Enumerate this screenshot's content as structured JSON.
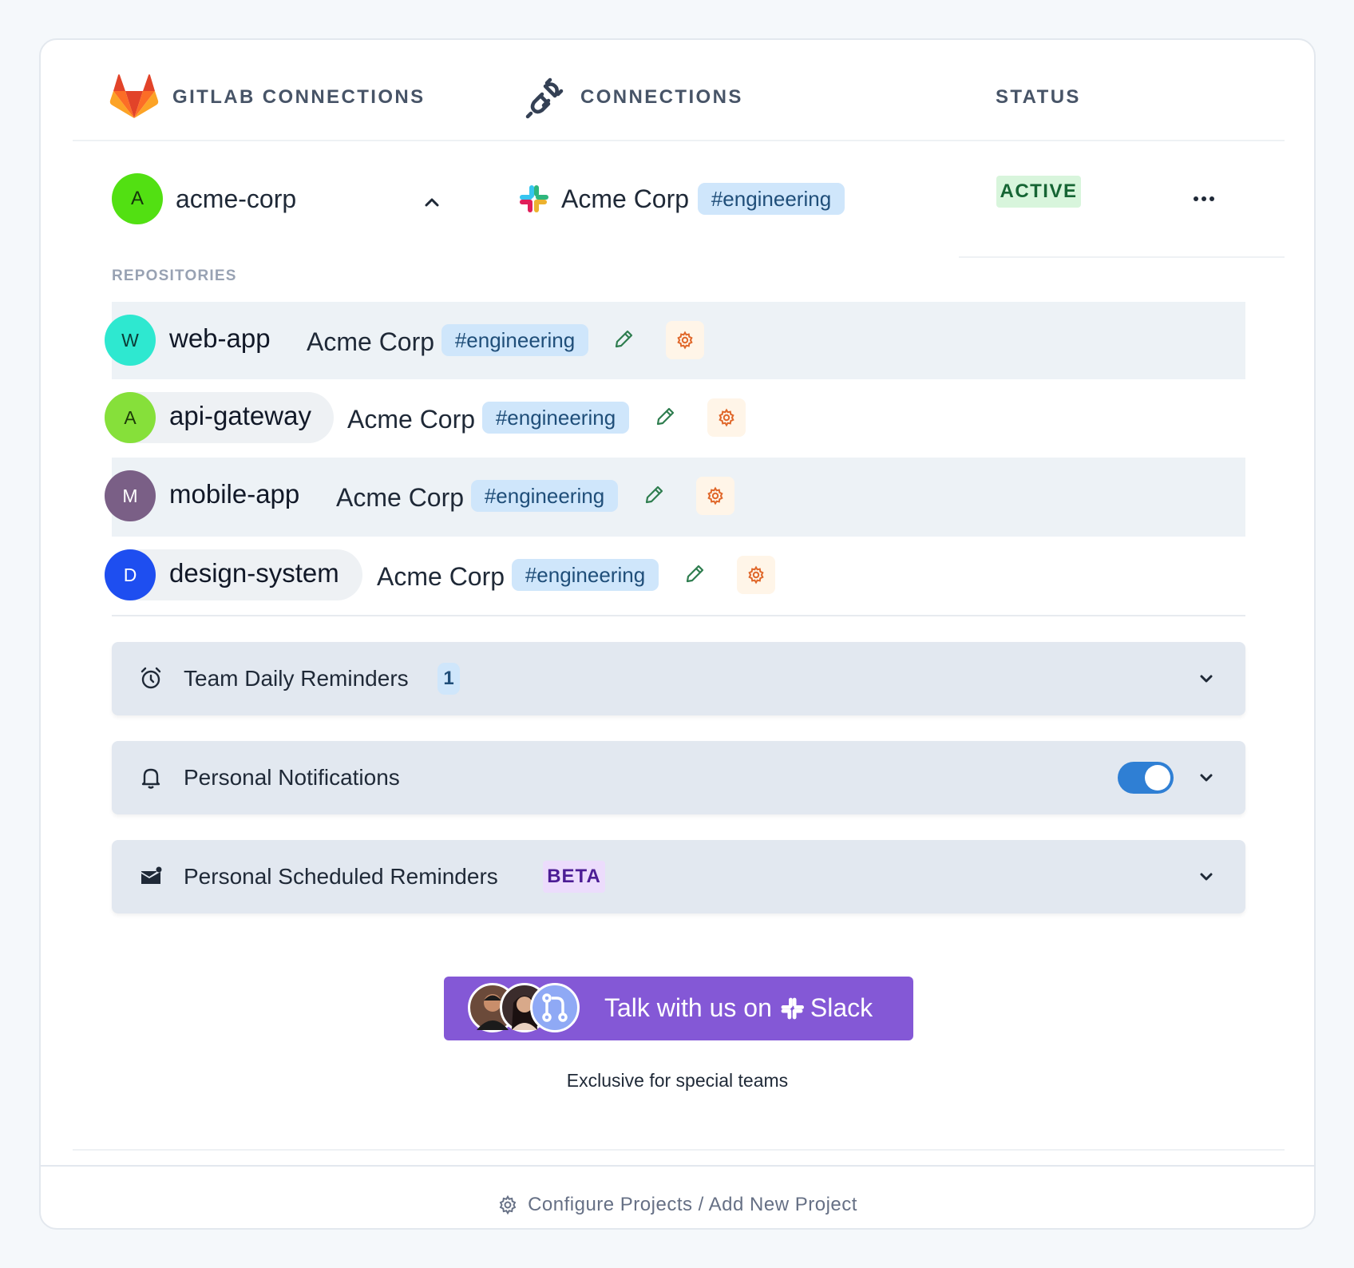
{
  "header": {
    "gitlab_label": "GITLAB CONNECTIONS",
    "connections_label": "CONNECTIONS",
    "status_label": "STATUS"
  },
  "connection": {
    "avatar_letter": "A",
    "avatar_color": "#52e012",
    "name": "acme-corp",
    "team": "Acme Corp",
    "channel": "#engineering",
    "status": "ACTIVE"
  },
  "repositories": {
    "title": "REPOSITORIES",
    "items": [
      {
        "letter": "W",
        "color": "#2ee8d0",
        "name": "web-app",
        "team": "Acme Corp",
        "channel": "#engineering"
      },
      {
        "letter": "A",
        "color": "#86e03a",
        "name": "api-gateway",
        "team": "Acme Corp",
        "channel": "#engineering"
      },
      {
        "letter": "M",
        "color": "#7a5f86",
        "name": "mobile-app",
        "team": "Acme Corp",
        "channel": "#engineering"
      },
      {
        "letter": "D",
        "color": "#1e4ef0",
        "name": "design-system",
        "team": "Acme Corp",
        "channel": "#engineering"
      }
    ]
  },
  "sections": {
    "team_reminders": {
      "label": "Team Daily Reminders",
      "count": "1"
    },
    "personal_notifications": {
      "label": "Personal Notifications",
      "enabled": true
    },
    "personal_scheduled": {
      "label": "Personal Scheduled Reminders",
      "badge": "BETA"
    }
  },
  "cta": {
    "text_before": "Talk with us on",
    "text_after": "Slack",
    "subtitle": "Exclusive for special teams"
  },
  "footer": {
    "link": "Configure Projects / Add New Project"
  },
  "colors": {
    "accent_blue": "#2f7fd4",
    "cta_purple": "#8458d6",
    "active_green": "#d8f5dc"
  }
}
